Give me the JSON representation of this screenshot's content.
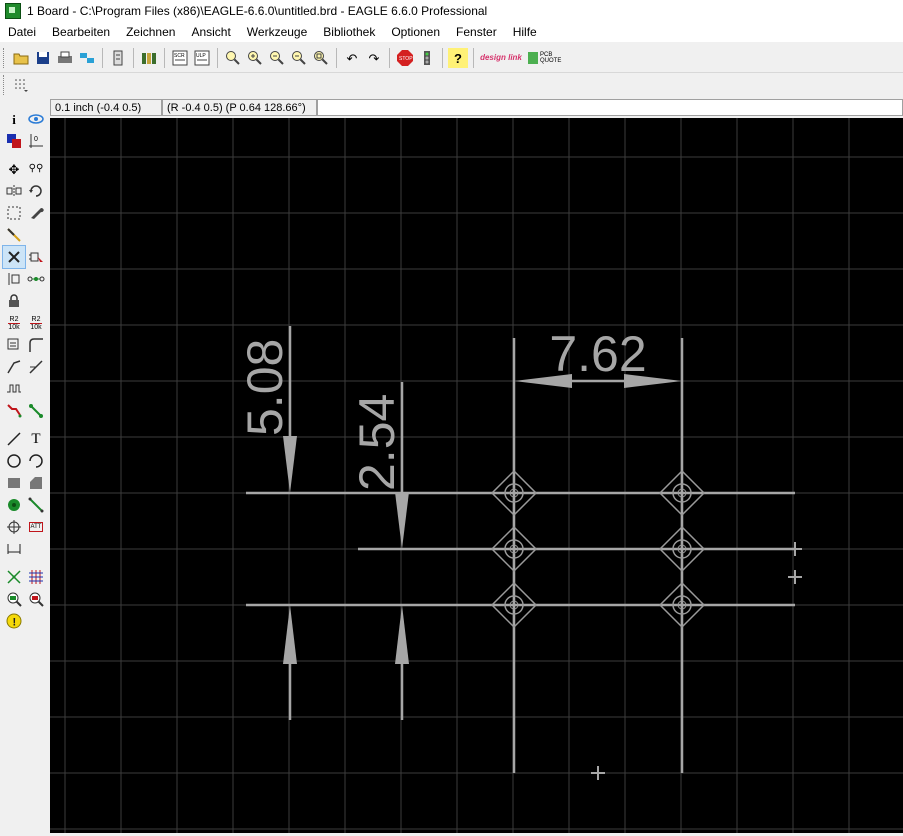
{
  "window": {
    "title": "1 Board - C:\\Program Files (x86)\\EAGLE-6.6.0\\untitled.brd - EAGLE 6.6.0 Professional"
  },
  "menu": [
    "Datei",
    "Bearbeiten",
    "Zeichnen",
    "Ansicht",
    "Werkzeuge",
    "Bibliothek",
    "Optionen",
    "Fenster",
    "Hilfe"
  ],
  "toolbar": {
    "buttons": [
      "open-icon",
      "save-icon",
      "print-icon",
      "cam-icon",
      "switch-editor-icon",
      "library-icon",
      "script-icon",
      "ulp-icon",
      "zoom-fit-icon",
      "zoom-in-icon",
      "zoom-out-icon",
      "zoom-redraw-icon",
      "zoom-select-icon",
      "undo-icon",
      "redo-icon",
      "stop-icon",
      "go-icon",
      "help-icon",
      "designlink-icon",
      "pcb-quote-icon"
    ],
    "designlink_label": "design link",
    "pcbquote_label": "PCB QUOTE"
  },
  "coord": {
    "grid": "0.1 inch (-0.4 0.5)",
    "position": "(R -0.4 0.5) (P 0.64 128.66°)",
    "command_value": ""
  },
  "leftbar": {
    "tools": [
      [
        "info-icon",
        "show-icon"
      ],
      [
        "display-icon",
        "mark-icon"
      ],
      [
        "move-icon",
        "copy-icon"
      ],
      [
        "mirror-icon",
        "rotate-icon"
      ],
      [
        "group-icon",
        "change-icon"
      ],
      [
        "cut-icon",
        ""
      ],
      [
        "delete-icon",
        "add-icon"
      ],
      [
        "replace-icon",
        "paste-icon"
      ],
      [
        "lock-icon",
        ""
      ],
      [
        "name-icon",
        "value-icon"
      ],
      [
        "smash-icon",
        "miter-icon"
      ],
      [
        "split-icon",
        "optimize-icon"
      ],
      [
        "meander-icon",
        ""
      ],
      [
        "route-icon",
        "ripup-icon"
      ],
      [
        "wire-icon",
        "text-icon"
      ],
      [
        "circle-icon",
        "arc-icon"
      ],
      [
        "rect-icon",
        "polygon-icon"
      ],
      [
        "via-icon",
        "signal-icon"
      ],
      [
        "hole-icon",
        "attribute-icon"
      ],
      [
        "dimension-icon",
        ""
      ],
      [
        "ratsnest-icon",
        "auto-icon"
      ],
      [
        "drc-icon",
        "errors-icon"
      ],
      [
        "erc-icon",
        ""
      ]
    ],
    "labels": {
      "name": "R2",
      "name_sub": "10k",
      "value": "R2",
      "value_sub": "10k",
      "attribute": "ATT"
    }
  },
  "board": {
    "dim_labels": [
      "5.08",
      "2.54",
      "7.62"
    ],
    "colors": {
      "background": "#000000",
      "grid": "#3c3c3c",
      "dimension": "#a6a6a6",
      "pad": "#9a9a9a"
    }
  }
}
